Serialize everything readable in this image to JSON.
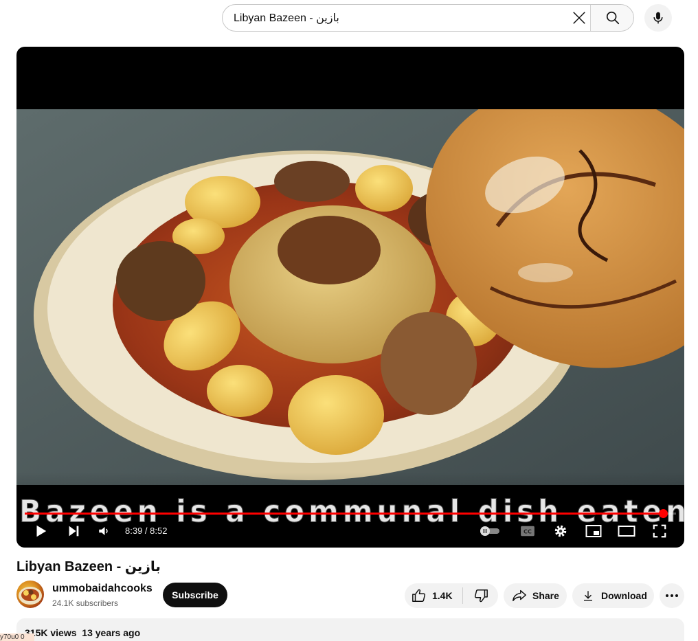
{
  "search": {
    "query": "Libyan Bazeen - بازين",
    "clear_icon": "close-icon",
    "search_icon": "search-icon",
    "mic_icon": "microphone-icon"
  },
  "player": {
    "caption": "Bazeen is a communal dish eaten with the hands",
    "time_current": "8:39",
    "time_total": "8:52",
    "time_display": "8:39 / 8:52",
    "progress_fraction": 0.98,
    "progress_color": "#ff0000",
    "icons": [
      "play-icon",
      "next-icon",
      "volume-icon",
      "autoplay-toggle-icon",
      "subtitles-icon",
      "settings-icon",
      "miniplayer-icon",
      "theater-mode-icon",
      "fullscreen-icon"
    ]
  },
  "video": {
    "title": "Libyan Bazeen - بازين",
    "channel": "ummobaidahcooks",
    "subscribers": "24.1K subscribers",
    "subscribe_label": "Subscribe",
    "like_count": "1.4K",
    "share_label": "Share",
    "download_label": "Download",
    "views": "315K views",
    "age": "13 years ago"
  },
  "overlay": {
    "text": "y70u0 0"
  }
}
